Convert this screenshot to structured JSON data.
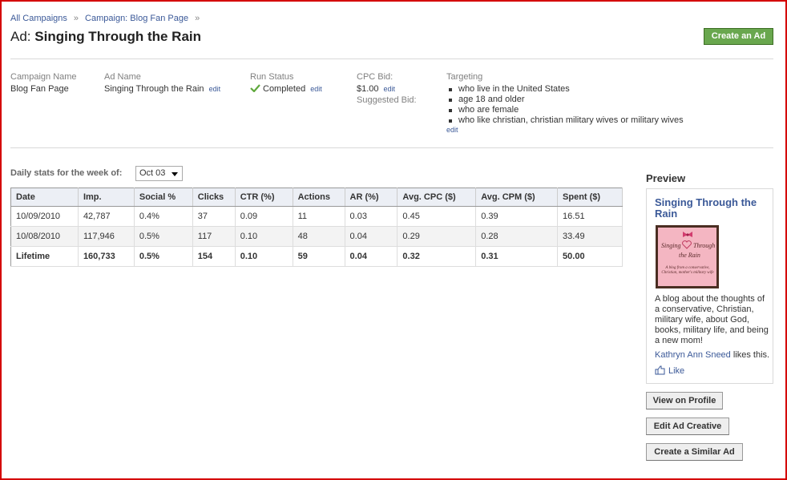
{
  "breadcrumb": {
    "all_campaigns": "All Campaigns",
    "sep1": "»",
    "campaign": "Campaign: Blog Fan Page",
    "sep2": "»"
  },
  "header": {
    "prefix": "Ad:",
    "title": "Singing Through the Rain",
    "create_button": "Create an Ad"
  },
  "details": {
    "campaign_name_label": "Campaign Name",
    "campaign_name": "Blog Fan Page",
    "ad_name_label": "Ad Name",
    "ad_name": "Singing Through the Rain",
    "run_status_label": "Run Status",
    "run_status": "Completed",
    "cpc_bid_label": "CPC Bid:",
    "cpc_bid": "$1.00",
    "suggested_bid_label": "Suggested Bid:",
    "targeting_label": "Targeting",
    "targeting": [
      "who live in the United States",
      "age 18 and older",
      "who are female",
      "who like christian, christian military wives or military wives"
    ],
    "edit_label": "edit"
  },
  "stats": {
    "daily_label": "Daily stats for the week of:",
    "week_value": "Oct 03",
    "columns": [
      "Date",
      "Imp.",
      "Social %",
      "Clicks",
      "CTR (%)",
      "Actions",
      "AR (%)",
      "Avg. CPC ($)",
      "Avg. CPM ($)",
      "Spent ($)"
    ],
    "rows": [
      [
        "10/09/2010",
        "42,787",
        "0.4%",
        "37",
        "0.09",
        "11",
        "0.03",
        "0.45",
        "0.39",
        "16.51"
      ],
      [
        "10/08/2010",
        "117,946",
        "0.5%",
        "117",
        "0.10",
        "48",
        "0.04",
        "0.29",
        "0.28",
        "33.49"
      ]
    ],
    "total": [
      "Lifetime",
      "160,733",
      "0.5%",
      "154",
      "0.10",
      "59",
      "0.04",
      "0.32",
      "0.31",
      "50.00"
    ]
  },
  "preview": {
    "heading": "Preview",
    "ad_title": "Singing Through the Rain",
    "image_text_1": "Singing",
    "image_text_2": "Through",
    "image_text_3": "the Rain",
    "image_tagline": "A blog from a conservative, Christian, mother's military wife",
    "body": "A blog about the thoughts of a conservative, Christian, military wife, about God, books, military life, and being a new mom!",
    "liker": "Kathryn Ann Sneed",
    "likes_suffix": "likes this.",
    "like_label": "Like"
  },
  "actions": {
    "view_profile": "View on Profile",
    "edit_creative": "Edit Ad Creative",
    "create_similar": "Create a Similar Ad"
  },
  "colors": {
    "frame": "#d40000",
    "link": "#3b5998",
    "create_button": "#69a74e",
    "table_header": "#eceff5",
    "check": "#5fa83c"
  },
  "icons": {
    "status": "check-icon",
    "dropdown": "chevron-down-icon",
    "like": "thumbs-up-icon"
  }
}
